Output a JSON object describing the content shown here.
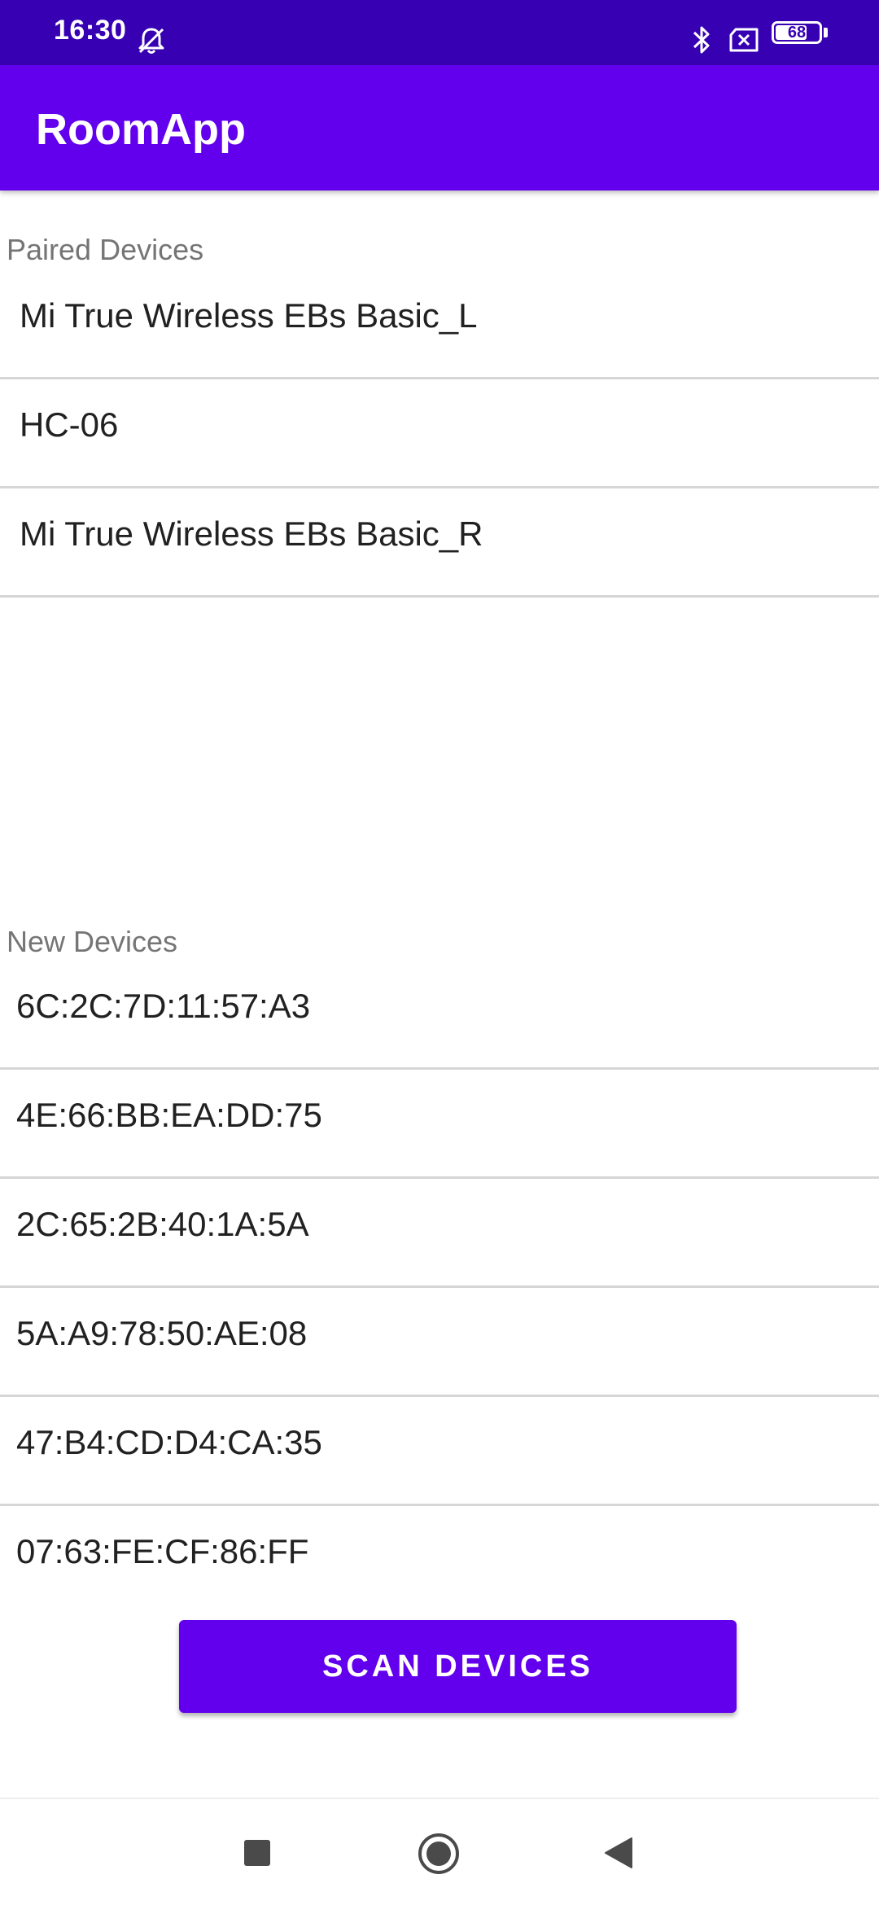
{
  "status_bar": {
    "time": "16:30",
    "battery_level": "68",
    "icons": [
      "mute-icon",
      "bluetooth-icon",
      "no-sim-icon",
      "battery-icon"
    ]
  },
  "app_bar": {
    "title": "RoomApp"
  },
  "paired": {
    "header": "Paired Devices",
    "items": [
      "Mi True Wireless EBs Basic_L",
      "HC-06",
      "Mi True Wireless EBs Basic_R"
    ]
  },
  "new_devices": {
    "header": "New Devices",
    "items": [
      "6C:2C:7D:11:57:A3",
      "4E:66:BB:EA:DD:75",
      "2C:65:2B:40:1A:5A",
      "5A:A9:78:50:AE:08",
      "47:B4:CD:D4:CA:35",
      "07:63:FE:CF:86:FF"
    ]
  },
  "scan_button": {
    "label": "SCAN DEVICES"
  },
  "nav_bar": {
    "icons": [
      "recents-square-icon",
      "home-circle-icon",
      "back-triangle-icon"
    ]
  },
  "colors": {
    "status_bar": "#3700b3",
    "primary": "#6200ee",
    "divider": "#d6d6d6",
    "section_label": "#757575"
  }
}
